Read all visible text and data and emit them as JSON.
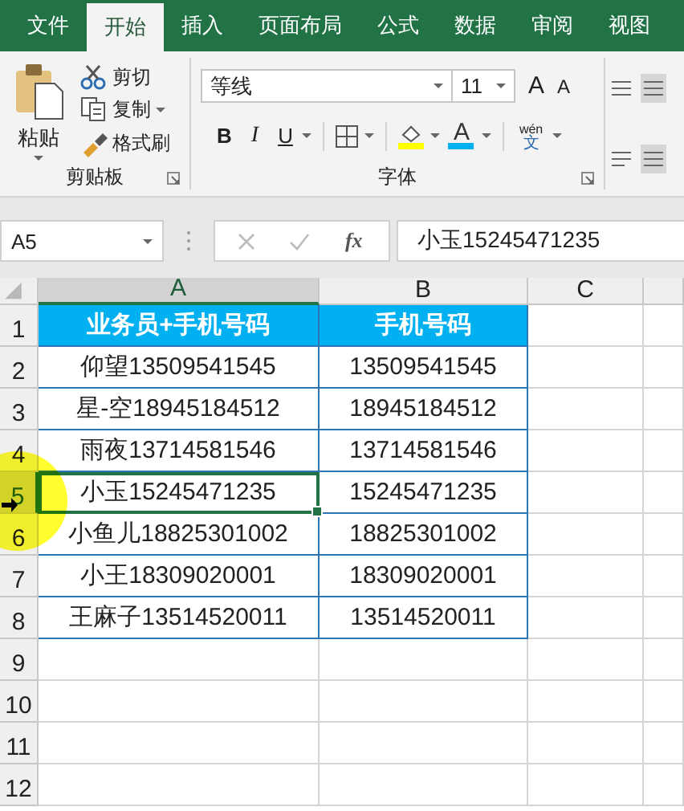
{
  "tabs": [
    {
      "label": "文件",
      "selected": false
    },
    {
      "label": "开始",
      "selected": true
    },
    {
      "label": "插入",
      "selected": false
    },
    {
      "label": "页面布局",
      "selected": false
    },
    {
      "label": "公式",
      "selected": false
    },
    {
      "label": "数据",
      "selected": false
    },
    {
      "label": "审阅",
      "selected": false
    },
    {
      "label": "视图",
      "selected": false
    }
  ],
  "clipboard": {
    "paste": "粘贴",
    "cut": "剪切",
    "copy": "复制",
    "format_painter": "格式刷",
    "group_label": "剪贴板"
  },
  "font": {
    "name": "等线",
    "size": "11",
    "grow": "A",
    "shrink": "A",
    "bold": "B",
    "italic": "I",
    "underline": "U",
    "font_color": "A",
    "phonetic_top": "wén",
    "phonetic_bottom": "文",
    "group_label": "字体"
  },
  "formula_bar": {
    "name_box": "A5",
    "fx": "fx",
    "formula": "小玉15245471235"
  },
  "sheet": {
    "columns": [
      {
        "label": "A",
        "selected": true
      },
      {
        "label": "B",
        "selected": false
      },
      {
        "label": "C",
        "selected": false
      }
    ],
    "rows": [
      {
        "number": "1",
        "selected": false,
        "kind": "header",
        "cells": [
          "业务员+手机号码",
          "手机号码"
        ]
      },
      {
        "number": "2",
        "selected": false,
        "kind": "data",
        "cells": [
          "仰望13509541545",
          "13509541545"
        ]
      },
      {
        "number": "3",
        "selected": false,
        "kind": "data",
        "cells": [
          "星-空18945184512",
          "18945184512"
        ]
      },
      {
        "number": "4",
        "selected": false,
        "kind": "data",
        "cells": [
          "雨夜13714581546",
          "13714581546"
        ]
      },
      {
        "number": "5",
        "selected": true,
        "kind": "data",
        "cells": [
          "小玉15245471235",
          "15245471235"
        ]
      },
      {
        "number": "6",
        "selected": false,
        "kind": "data",
        "cells": [
          "小鱼儿18825301002",
          "18825301002"
        ]
      },
      {
        "number": "7",
        "selected": false,
        "kind": "data",
        "cells": [
          "小王18309020001",
          "18309020001"
        ]
      },
      {
        "number": "8",
        "selected": false,
        "kind": "data",
        "cells": [
          "王麻子13514520011",
          "13514520011"
        ]
      },
      {
        "number": "9",
        "selected": false,
        "kind": "empty"
      },
      {
        "number": "10",
        "selected": false,
        "kind": "empty"
      },
      {
        "number": "11",
        "selected": false,
        "kind": "empty"
      },
      {
        "number": "12",
        "selected": false,
        "kind": "empty"
      }
    ]
  }
}
